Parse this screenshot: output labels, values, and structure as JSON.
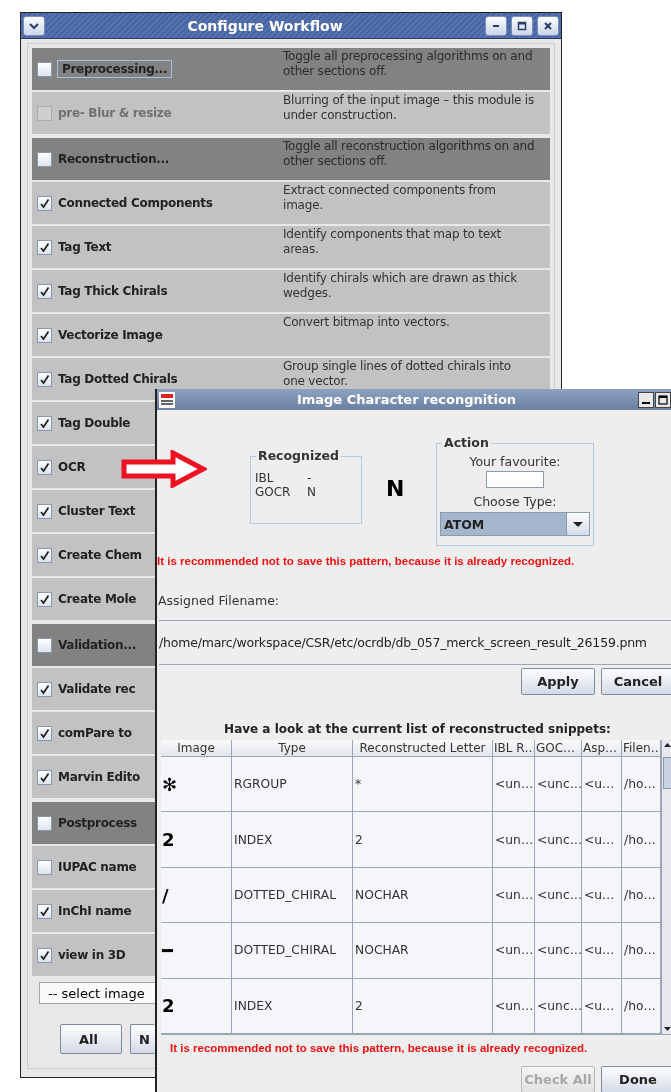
{
  "workflow": {
    "title": "Configure Workflow",
    "groups": [
      {
        "rows": [
          {
            "kind": "section",
            "label": "Preprocessing...",
            "checked": false,
            "focused": true,
            "disabled": false,
            "description": "Toggle all preprocessing algorithms on and other sections off."
          },
          {
            "kind": "option",
            "label": "pre- Blur & resize",
            "checked": false,
            "focused": false,
            "disabled": true,
            "description": "Blurring of the input image – this module is under construction."
          }
        ]
      },
      {
        "rows": [
          {
            "kind": "section",
            "label": "Reconstruction...",
            "checked": false,
            "focused": false,
            "disabled": false,
            "description": "Toggle all reconstruction algorithms on and other sections off."
          },
          {
            "kind": "option",
            "label": "Connected Components",
            "checked": true,
            "focused": false,
            "disabled": false,
            "description": "Extract connected components from image."
          },
          {
            "kind": "option",
            "label": "Tag Text",
            "checked": true,
            "focused": false,
            "disabled": false,
            "description": "Identify components that map to text areas."
          },
          {
            "kind": "option",
            "label": "Tag Thick Chirals",
            "checked": true,
            "focused": false,
            "disabled": false,
            "description": "Identify chirals which are drawn as thick wedges."
          },
          {
            "kind": "option",
            "label": "Vectorize Image",
            "checked": true,
            "focused": false,
            "disabled": false,
            "description": "Convert bitmap into vectors."
          },
          {
            "kind": "option",
            "label": "Tag Dotted Chirals",
            "checked": true,
            "focused": false,
            "disabled": false,
            "description": "Group single lines of dotted chirals into one vector."
          },
          {
            "kind": "option",
            "label": "Tag Double",
            "checked": true,
            "focused": false,
            "disabled": false
          },
          {
            "kind": "option",
            "label": "OCR",
            "checked": true,
            "focused": false,
            "disabled": false
          },
          {
            "kind": "option",
            "label": "Cluster Text",
            "checked": true,
            "focused": false,
            "disabled": false
          },
          {
            "kind": "option",
            "label": "Create Chem",
            "checked": true,
            "focused": false,
            "disabled": false
          },
          {
            "kind": "option",
            "label": "Create Mole",
            "checked": true,
            "focused": false,
            "disabled": false
          }
        ]
      },
      {
        "rows": [
          {
            "kind": "section",
            "label": "Validation...",
            "checked": false,
            "focused": false,
            "disabled": false
          },
          {
            "kind": "option",
            "label": "Validate rec",
            "checked": true,
            "focused": false,
            "disabled": false
          },
          {
            "kind": "option",
            "label": "comPare to",
            "checked": true,
            "focused": false,
            "disabled": false
          },
          {
            "kind": "option",
            "label": "Marvin Edito",
            "checked": true,
            "focused": false,
            "disabled": false
          }
        ]
      },
      {
        "rows": [
          {
            "kind": "section",
            "label": "Postprocess",
            "checked": false,
            "focused": false,
            "disabled": false
          },
          {
            "kind": "option",
            "label": "IUPAC name",
            "checked": false,
            "focused": false,
            "disabled": false
          },
          {
            "kind": "option",
            "label": "InChI name",
            "checked": true,
            "focused": false,
            "disabled": false
          },
          {
            "kind": "option",
            "label": "view in 3D",
            "checked": true,
            "focused": false,
            "disabled": false
          }
        ]
      }
    ],
    "image_select": "-- select image",
    "buttons": [
      {
        "label": "All"
      },
      {
        "label": "N"
      }
    ]
  },
  "recognition": {
    "title": "Image Character recongnition",
    "recognized": {
      "legend": "Recognized",
      "rows": [
        {
          "engine": "IBL",
          "value": "-"
        },
        {
          "engine": "GOCR",
          "value": "N"
        }
      ]
    },
    "glyph": "N",
    "action": {
      "legend": "Action",
      "favourite_label": "Your favourite:",
      "type_label": "Choose Type:",
      "type_value": "ATOM"
    },
    "warning": "It is recommended not to save this pattern, because it is already recognized.",
    "filename_label": "Assigned Filename:",
    "filename": "/home/marc/workspace/CSR/etc/ocrdb/db_057_merck_screen_result_26159.pnm",
    "buttons": [
      {
        "label": "Apply",
        "disabled": false
      },
      {
        "label": "Cancel",
        "disabled": false
      }
    ],
    "table": {
      "caption": "Have a look at the current list of reconstructed snippets:",
      "columns": [
        "Image",
        "Type",
        "Reconstructed Letter",
        "IBL R…",
        "GOC…",
        "Asp…",
        "Filen…"
      ],
      "rows": [
        {
          "cells": [
            "✻",
            "RGROUP",
            "*",
            "<un…",
            "<unc…",
            "<u…",
            "/ho…"
          ]
        },
        {
          "cells": [
            "2",
            "INDEX",
            "2",
            "<un…",
            "<unc…",
            "<u…",
            "/ho…"
          ]
        },
        {
          "cells": [
            "/",
            "DOTTED_CHIRAL",
            "NOCHAR",
            "<un…",
            "<unc…",
            "<u…",
            "/ho…"
          ]
        },
        {
          "cells": [
            "━",
            "DOTTED_CHIRAL",
            "NOCHAR",
            "<un…",
            "<unc…",
            "<u…",
            "/ho…"
          ]
        },
        {
          "cells": [
            "2",
            "INDEX",
            "2",
            "<un…",
            "<unc…",
            "<u…",
            "/ho…"
          ]
        }
      ]
    },
    "footer_warning": "It is recommended not to save this pattern, because it is already recognized.",
    "footer_buttons": [
      {
        "label": "Check All",
        "disabled": true
      },
      {
        "label": "Done",
        "disabled": false
      }
    ]
  }
}
